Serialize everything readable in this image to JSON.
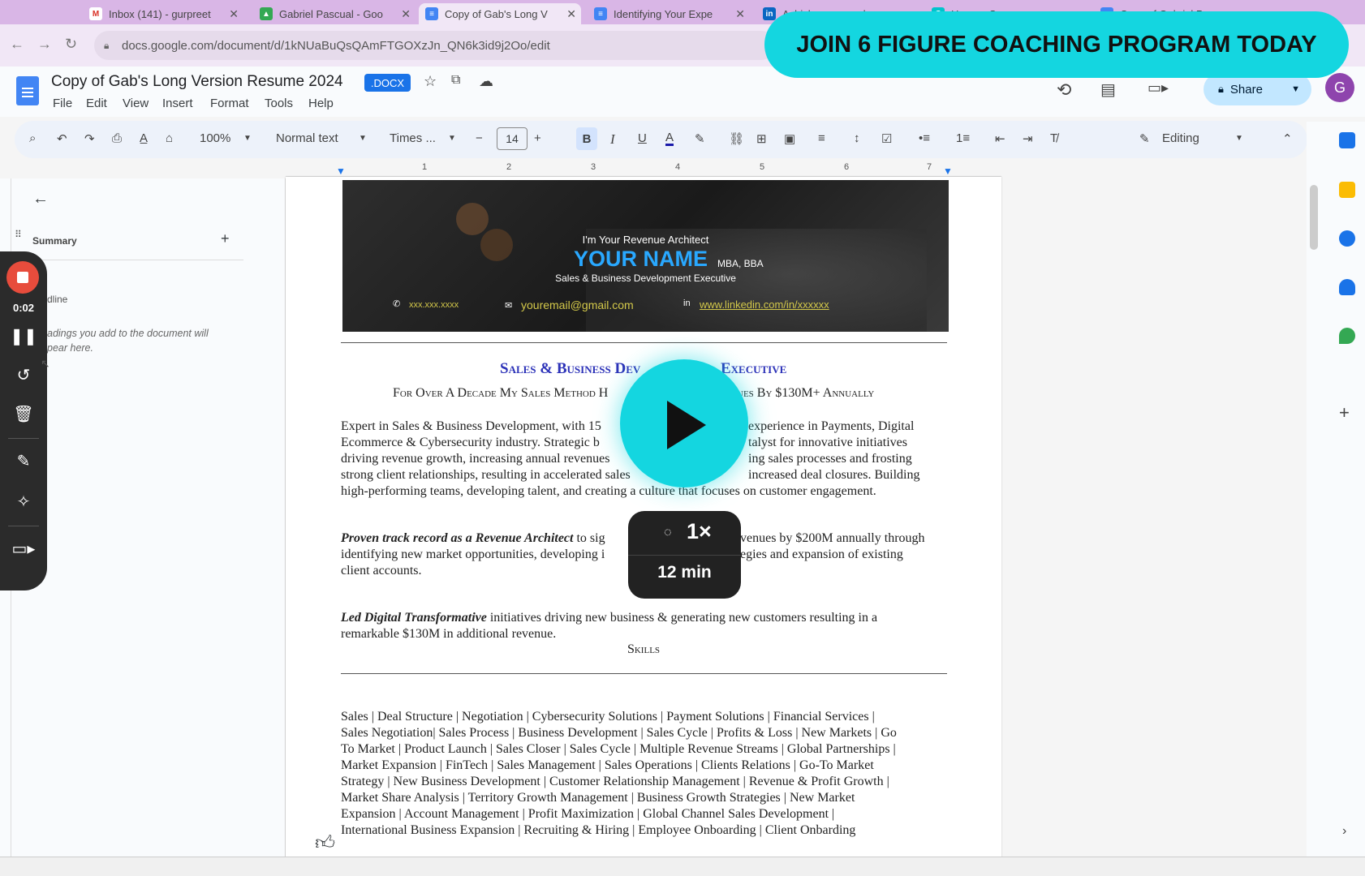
{
  "browser": {
    "tabs": [
      {
        "label": "Inbox (141) - gurpreet",
        "icon": "gmail-icon"
      },
      {
        "label": "Gabriel Pascual - Goo",
        "icon": "drive-icon"
      },
      {
        "label": "Copy of Gab's Long V",
        "icon": "docs-icon"
      },
      {
        "label": "Identifying Your Expe",
        "icon": "docs-icon"
      },
      {
        "label": "Ashish messaged you",
        "icon": "linkedin-icon"
      },
      {
        "label": "Home - Canva",
        "icon": "canva-icon"
      },
      {
        "label": "Copy of Gabriel Pasc",
        "icon": "slides-icon"
      }
    ],
    "url": "docs.google.com/document/d/1kNUaBuQsQAmFTGOXzJn_QN6k3id9j2Oo/edit"
  },
  "banner": {
    "text": "JOIN 6 FIGURE COACHING PROGRAM TODAY"
  },
  "docs": {
    "title": "Copy of Gab's Long Version Resume 2024",
    "badge": ".DOCX",
    "menu": [
      "File",
      "Edit",
      "View",
      "Insert",
      "Format",
      "Tools",
      "Help"
    ],
    "share_label": "Share",
    "avatar_letter": "G"
  },
  "toolbar": {
    "zoom": "100%",
    "style": "Normal text",
    "font": "Times ...",
    "font_size": "14",
    "bold": "B",
    "italic": "I",
    "underline": "U",
    "text_color": "A",
    "mode": "Editing"
  },
  "ruler": {
    "numbers": [
      "1",
      "2",
      "3",
      "4",
      "5",
      "6",
      "7"
    ]
  },
  "outline": {
    "section": "Summary",
    "heading_partial": "dline",
    "hint": "adings you add to the document will\npear here."
  },
  "recorder": {
    "time": "0:02"
  },
  "resume": {
    "hero": {
      "tagline": "I'm Your Revenue Architect",
      "name": "YOUR NAME",
      "credentials": "MBA, BBA",
      "role": "Sales & Business Development Executive",
      "phone": "xxx.xxx.xxxx",
      "email": "youremail@gmail.com",
      "linkedin": "www.linkedin.com/in/xxxxxx"
    },
    "heading_left": "Sales & Business Dev",
    "heading_right": "Executive",
    "subheading_left": "For Over A Decade My Sales Method H",
    "subheading_right": "ues By $130M+ Annually",
    "para1": [
      "Expert in Sales & Business Development, with 15",
      "Ecommerce & Cybersecurity industry.  Strategic b",
      "driving revenue growth, increasing annual revenues",
      "strong client relationships, resulting in accelerated sales",
      "high-performing teams, developing talent, and creating a culture that focuses on customer engagement."
    ],
    "para1_right": [
      "experience in Payments, Digital",
      "talyst for innovative initiatives",
      "ing sales processes and frosting",
      "increased deal closures.  Building"
    ],
    "para2_bold": "Proven track record as a Revenue Architect",
    "para2_line1": " to sig",
    "para2_line1_right": "venues by $200M annually through",
    "para2_line2": "identifying new market opportunities, developing i",
    "para2_line2_right": "egies and expansion of existing",
    "para2_line3": "client accounts.",
    "para3_bold": "Led Digital Transformative",
    "para3_line1": " initiatives driving new business & generating new customers resulting in a",
    "para3_line2": "remarkable $130M in additional revenue.",
    "skills_heading": "Skills",
    "skills": [
      "Sales | Deal Structure | Negotiation | Cybersecurity Solutions | Payment Solutions | Financial Services |",
      "Sales Negotiation| Sales Process | Business Development | Sales Cycle | Profits & Loss | New Markets | Go",
      "To Market | Product Launch | Sales Closer | Sales Cycle | Multiple Revenue Streams | Global Partnerships |",
      "Market Expansion | FinTech | Sales Management | Sales Operations | Clients Relations | Go-To Market",
      "Strategy | New Business Development | Customer Relationship Management | Revenue & Profit Growth |",
      "Market Share Analysis | Territory Growth Management | Business Growth Strategies | New Market",
      "Expansion | Account Management | Profit Maximization | Global Channel Sales Development |",
      "International Business Expansion | Recruiting & Hiring | Employee Onboarding | Client Onbarding"
    ]
  },
  "video": {
    "speed": "1×",
    "duration": "12 min"
  }
}
